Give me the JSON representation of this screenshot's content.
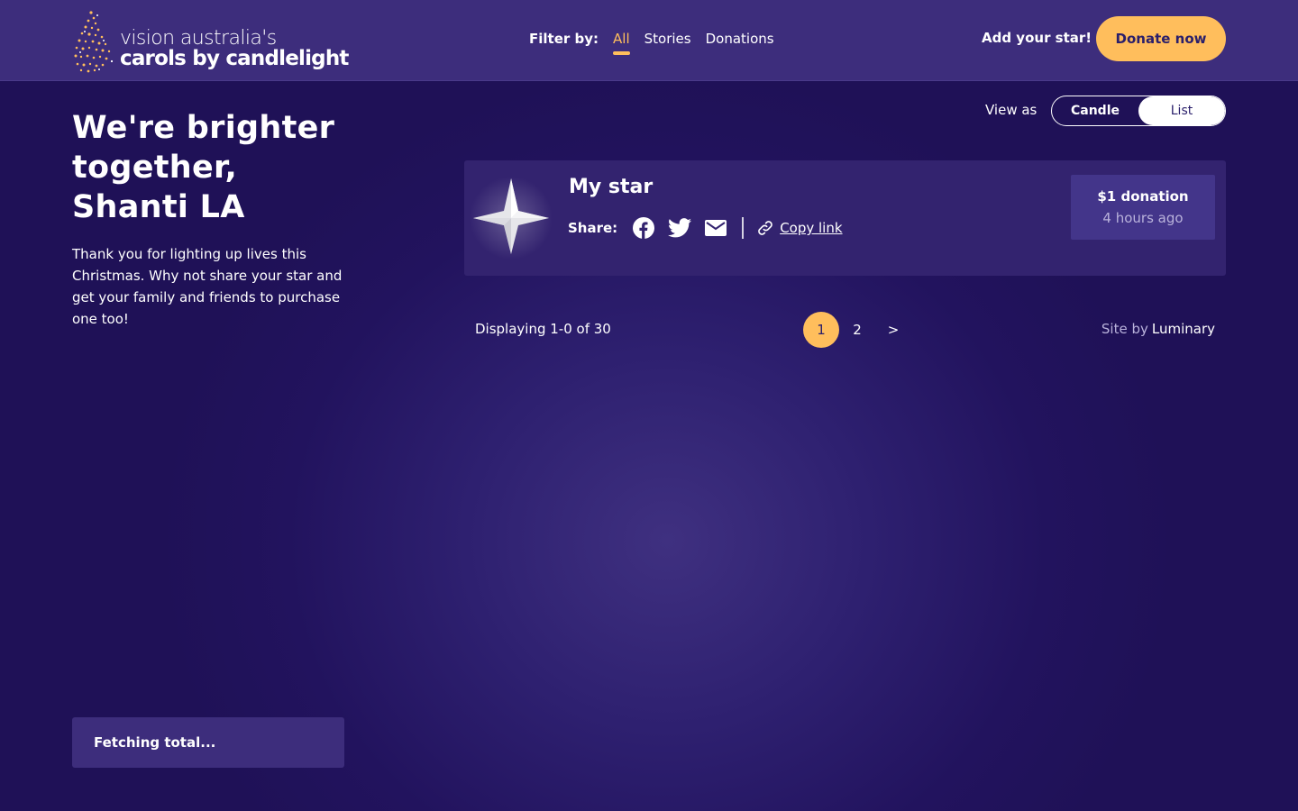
{
  "header": {
    "logo_line1": "vision australia's",
    "logo_line2": "carols by candlelight",
    "filter_label": "Filter by:",
    "filters": [
      "All",
      "Stories",
      "Donations"
    ],
    "active_filter": "All",
    "add_star": "Add your star!",
    "donate_label": "Donate now"
  },
  "intro": {
    "headline": "We're brighter together, Shanti LA",
    "body": "Thank you for lighting up lives this Christmas. Why not share your star and get your family and friends to purchase one too!",
    "total": "Fetching total..."
  },
  "view": {
    "label": "View as",
    "options": [
      "Candle",
      "List"
    ],
    "selected": "List"
  },
  "card": {
    "title": "My star",
    "share_label": "Share:",
    "share_icons": [
      "facebook-icon",
      "twitter-icon",
      "email-icon"
    ],
    "copy_link": "Copy link",
    "donation": "$1 donation",
    "time": "4 hours ago"
  },
  "pagination": {
    "displaying": "Displaying 1-0 of 30",
    "pages": [
      "1",
      "2",
      ">"
    ],
    "current": "1"
  },
  "footer": {
    "site_by": "Site by",
    "brand": "Luminary"
  },
  "colors": {
    "accent": "#ffbe5c",
    "header_bg": "#3d2d7c",
    "page_bg": "#22135e",
    "card_bg": "#33236f"
  }
}
